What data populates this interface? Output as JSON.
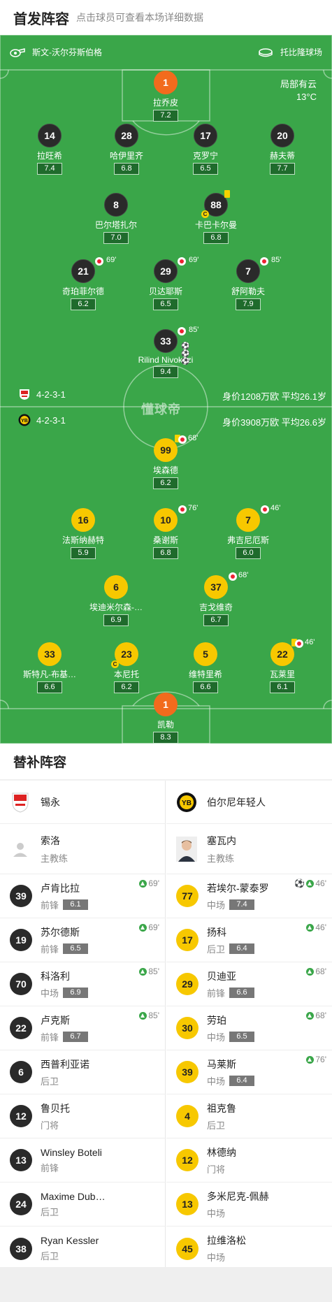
{
  "header": {
    "title": "首发阵容",
    "subtitle": "点击球员可查看本场详细数据"
  },
  "match": {
    "referee": "斯文-沃尔芬斯伯格",
    "stadium": "托比隆球场",
    "weather": "局部有云",
    "temperature": "13°C",
    "watermark": "懂球帝"
  },
  "home": {
    "formation": "4-2-3-1",
    "value": "身价1208万欧 平均26.1岁"
  },
  "away": {
    "formation": "4-2-3-1",
    "value": "身价3908万欧 平均26.6岁"
  },
  "home_players": [
    {
      "n": "1",
      "name": "拉乔皮",
      "r": "7.2"
    },
    {
      "n": "14",
      "name": "拉旺希",
      "r": "7.4"
    },
    {
      "n": "28",
      "name": "哈伊里齐",
      "r": "6.8"
    },
    {
      "n": "17",
      "name": "克罗宁",
      "r": "6.5"
    },
    {
      "n": "20",
      "name": "赫夫蒂",
      "r": "7.7"
    },
    {
      "n": "8",
      "name": "巴尔塔扎尔",
      "r": "7.0"
    },
    {
      "n": "88",
      "name": "卡巴卡尔曼",
      "r": "6.8"
    },
    {
      "n": "21",
      "name": "奇珀菲尔德",
      "r": "6.2",
      "sub": "69'"
    },
    {
      "n": "29",
      "name": "贝达耶斯",
      "r": "6.5",
      "sub": "69'"
    },
    {
      "n": "7",
      "name": "舒阿勒夫",
      "r": "7.9",
      "sub": "85'"
    },
    {
      "n": "33",
      "name": "Rilind Nivokazi",
      "r": "9.4",
      "sub": "85'"
    }
  ],
  "away_players": [
    {
      "n": "99",
      "name": "埃森德",
      "r": "6.2",
      "sub": "68'"
    },
    {
      "n": "16",
      "name": "法斯纳赫特",
      "r": "5.9"
    },
    {
      "n": "10",
      "name": "桑谢斯",
      "r": "6.8",
      "sub": "76'"
    },
    {
      "n": "7",
      "name": "弗吉尼厄斯",
      "r": "6.0",
      "sub": "46'"
    },
    {
      "n": "6",
      "name": "埃迪米尔森-…",
      "r": "6.9"
    },
    {
      "n": "37",
      "name": "吉戈维奇",
      "r": "6.7",
      "sub": "68'"
    },
    {
      "n": "33",
      "name": "斯特凡-布基…",
      "r": "6.6"
    },
    {
      "n": "23",
      "name": "本尼托",
      "r": "6.2"
    },
    {
      "n": "5",
      "name": "维特里希",
      "r": "6.6"
    },
    {
      "n": "22",
      "name": "瓦莱里",
      "r": "6.1",
      "sub": "46'"
    },
    {
      "n": "1",
      "name": "凯勒",
      "r": "8.3"
    }
  ],
  "subs_title": "替补阵容",
  "left_team": {
    "name": "锡永",
    "coach": "索洛",
    "coach_role": "主教练",
    "subs": [
      {
        "n": "39",
        "name": "卢肯比拉",
        "pos": "前锋",
        "r": "6.1",
        "min": "69'"
      },
      {
        "n": "19",
        "name": "苏尔德斯",
        "pos": "前锋",
        "r": "6.5",
        "min": "69'"
      },
      {
        "n": "70",
        "name": "科洛利",
        "pos": "中场",
        "r": "6.9",
        "min": "85'"
      },
      {
        "n": "22",
        "name": "卢克斯",
        "pos": "前锋",
        "r": "6.7",
        "min": "85'"
      },
      {
        "n": "6",
        "name": "西普利亚诺",
        "pos": "后卫"
      },
      {
        "n": "12",
        "name": "鲁贝托",
        "pos": "门将"
      },
      {
        "n": "13",
        "name": "Winsley Boteli",
        "pos": "前锋"
      },
      {
        "n": "24",
        "name": "Maxime Dub…",
        "pos": "后卫"
      },
      {
        "n": "38",
        "name": "Ryan Kessler",
        "pos": "后卫"
      }
    ]
  },
  "right_team": {
    "name": "伯尔尼年轻人",
    "coach": "塞瓦内",
    "coach_role": "主教练",
    "subs": [
      {
        "n": "77",
        "name": "若埃尔-蒙泰罗",
        "pos": "中场",
        "r": "7.4",
        "min": "46'"
      },
      {
        "n": "17",
        "name": "扬科",
        "pos": "后卫",
        "r": "6.4",
        "min": "46'"
      },
      {
        "n": "29",
        "name": "贝迪亚",
        "pos": "前锋",
        "r": "6.6",
        "min": "68'"
      },
      {
        "n": "30",
        "name": "劳珀",
        "pos": "中场",
        "r": "6.5",
        "min": "68'"
      },
      {
        "n": "39",
        "name": "马莱斯",
        "pos": "中场",
        "r": "6.4",
        "min": "76'"
      },
      {
        "n": "4",
        "name": "祖克鲁",
        "pos": "后卫"
      },
      {
        "n": "12",
        "name": "林德纳",
        "pos": "门将"
      },
      {
        "n": "13",
        "name": "多米尼克-佩赫",
        "pos": "中场"
      },
      {
        "n": "45",
        "name": "拉维洛松",
        "pos": "中场"
      }
    ]
  },
  "colors": {
    "pitch": "#3aa649",
    "home": "#2a2a2a",
    "away": "#f7c800",
    "keeper": "#f26b1d"
  }
}
